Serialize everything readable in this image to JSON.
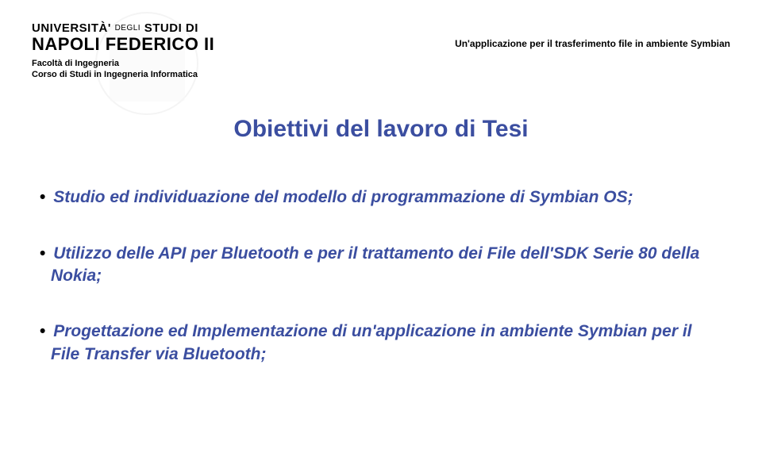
{
  "header": {
    "logo_line1_a": "UNIVERSITÀ",
    "logo_line1_b": "DEGLI",
    "logo_line1_c": "STUDI DI",
    "logo_line2": "NAPOLI FEDERICO II",
    "sub_line1": "Facoltà di Ingegneria",
    "sub_line2": "Corso di Studi in Ingegneria Informatica",
    "right_text": "Un'applicazione per il trasferimento file in ambiente Symbian"
  },
  "title": "Obiettivi del lavoro di Tesi",
  "bullets": {
    "b1": "Studio ed individuazione del modello di programmazione di Symbian OS;",
    "b2": "Utilizzo delle API per Bluetooth e per il trattamento dei File dell'SDK Serie 80 della Nokia;",
    "b3": "Progettazione ed Implementazione di un'applicazione in ambiente Symbian per il File Transfer via Bluetooth;"
  }
}
